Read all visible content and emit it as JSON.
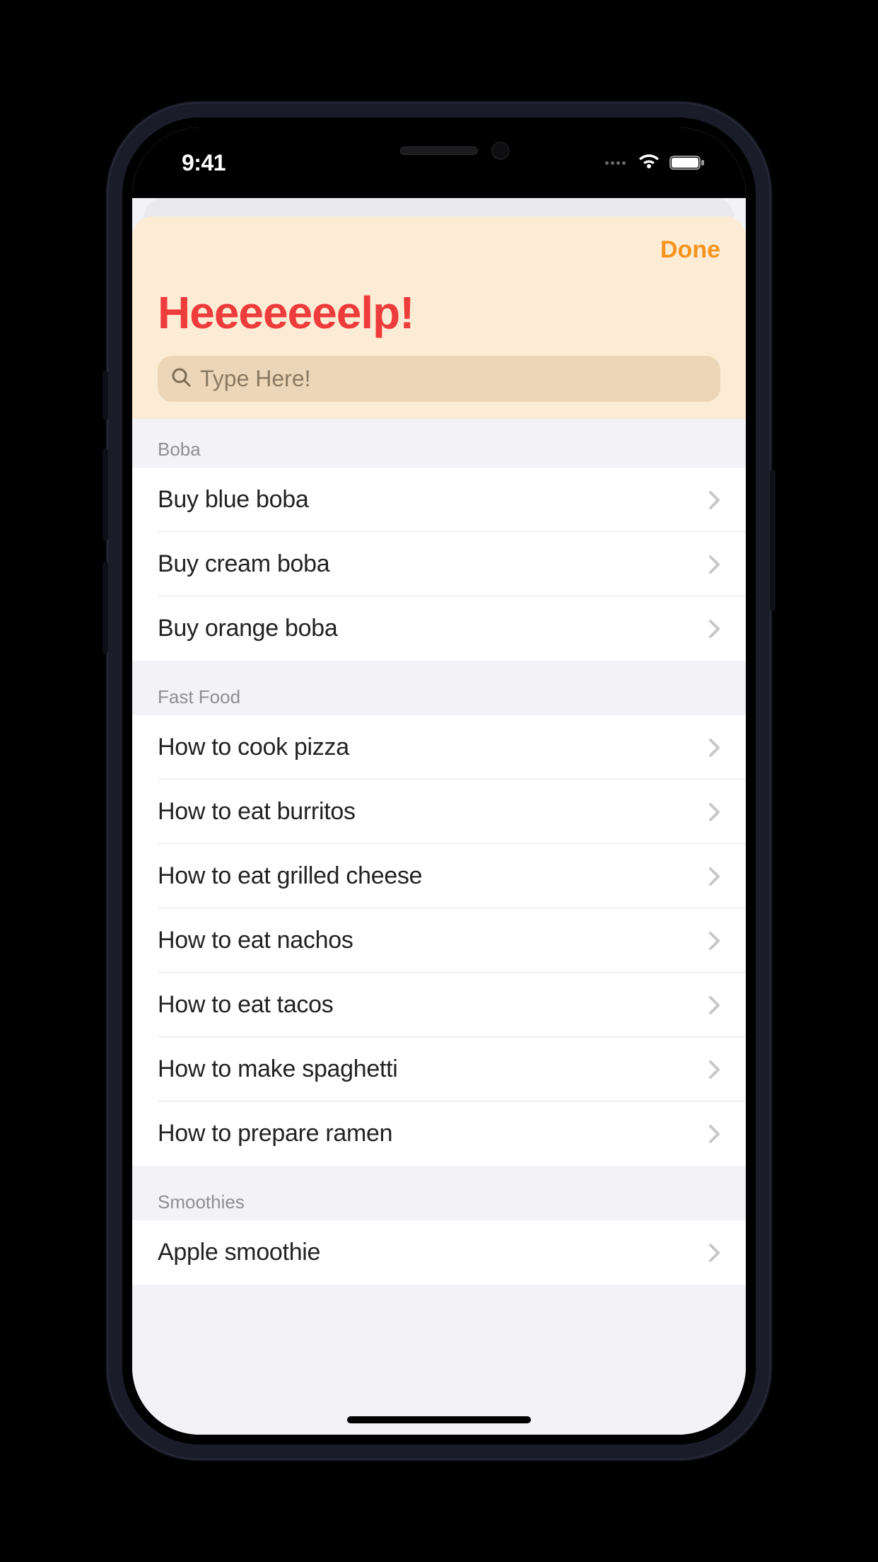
{
  "status": {
    "time": "9:41"
  },
  "header": {
    "done_label": "Done",
    "title": "Heeeeeeelp!",
    "search_placeholder": "Type Here!"
  },
  "sections": [
    {
      "title": "Boba",
      "items": [
        "Buy blue boba",
        "Buy cream boba",
        "Buy orange boba"
      ]
    },
    {
      "title": "Fast Food",
      "items": [
        "How to cook pizza",
        "How to eat burritos",
        "How to eat grilled cheese",
        "How to eat nachos",
        "How to eat tacos",
        "How to make spaghetti",
        "How to prepare ramen"
      ]
    },
    {
      "title": "Smoothies",
      "items": [
        "Apple smoothie"
      ]
    }
  ]
}
